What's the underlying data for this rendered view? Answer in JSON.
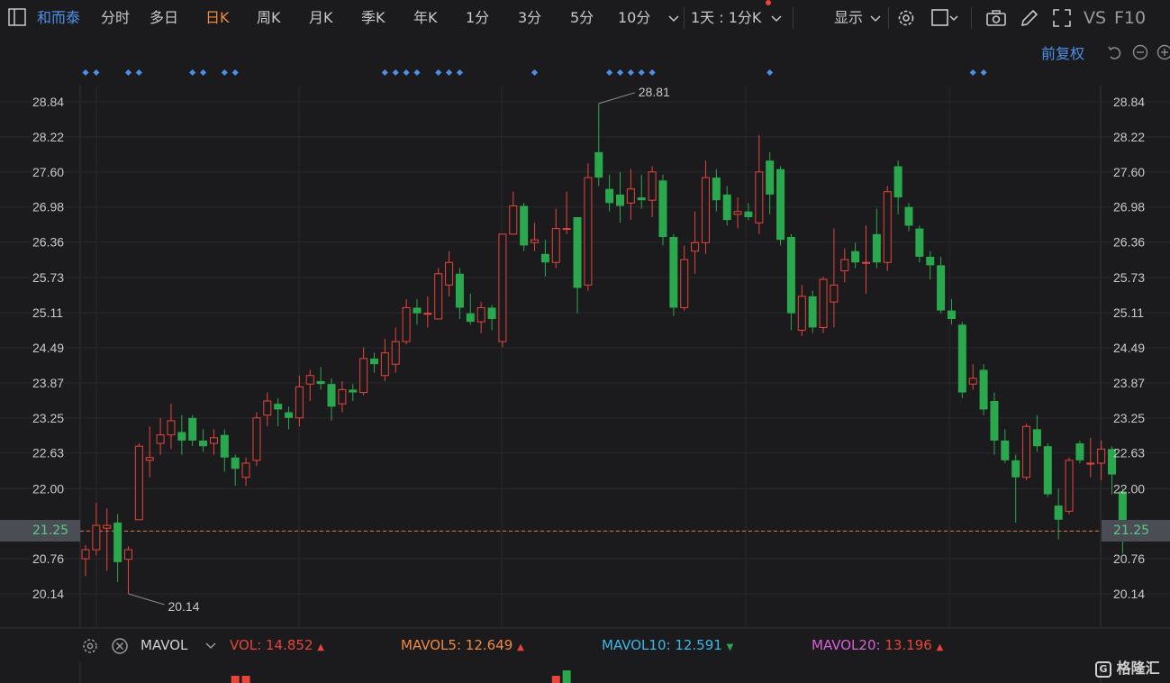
{
  "toolbar": {
    "stock_name": "和而泰",
    "tabs": [
      "分时",
      "多日",
      "日K",
      "周K",
      "月K",
      "季K",
      "年K",
      "1分",
      "3分",
      "5分",
      "10分"
    ],
    "active_tab": "日K",
    "interval_select": "1天 : 1分K",
    "display_label": "显示",
    "vs_label": "VS",
    "f10_label": "F10",
    "icons": [
      "layout-icon",
      "chevron-down-icon",
      "gear-icon",
      "square-icon",
      "camera-icon",
      "pencil-icon",
      "expand-icon"
    ]
  },
  "adjust_label": "前复权",
  "chart_data": {
    "type": "candlestick",
    "y_ticks": [
      "28.84",
      "28.22",
      "27.60",
      "26.98",
      "26.36",
      "25.73",
      "25.11",
      "24.49",
      "23.87",
      "23.25",
      "22.63",
      "22.00",
      "21.25",
      "20.76",
      "20.14"
    ],
    "ylim": [
      19.75,
      29.2
    ],
    "current_price": "21.25",
    "high_label": "28.81",
    "low_label": "20.14",
    "candles": [
      [
        20.76,
        20.92,
        20.45,
        21.0
      ],
      [
        20.92,
        21.35,
        20.82,
        21.75
      ],
      [
        21.3,
        21.35,
        20.55,
        21.65
      ],
      [
        21.4,
        20.7,
        20.35,
        21.55
      ],
      [
        20.75,
        20.92,
        20.14,
        20.98
      ],
      [
        21.45,
        22.75,
        21.45,
        22.8
      ],
      [
        22.5,
        22.55,
        22.2,
        23.1
      ],
      [
        22.8,
        22.95,
        22.6,
        23.25
      ],
      [
        22.95,
        23.2,
        22.7,
        23.5
      ],
      [
        23.0,
        22.85,
        22.6,
        23.3
      ],
      [
        23.25,
        22.85,
        22.75,
        23.3
      ],
      [
        22.85,
        22.75,
        22.65,
        23.05
      ],
      [
        22.8,
        22.9,
        22.6,
        23.05
      ],
      [
        22.95,
        22.55,
        22.3,
        23.05
      ],
      [
        22.55,
        22.35,
        22.05,
        22.6
      ],
      [
        22.2,
        22.45,
        22.05,
        22.55
      ],
      [
        22.5,
        23.25,
        22.4,
        23.35
      ],
      [
        23.3,
        23.55,
        23.1,
        23.7
      ],
      [
        23.5,
        23.4,
        23.1,
        23.6
      ],
      [
        23.35,
        23.25,
        23.05,
        23.45
      ],
      [
        23.25,
        23.8,
        23.1,
        24.0
      ],
      [
        23.85,
        24.0,
        23.55,
        24.1
      ],
      [
        23.9,
        23.85,
        23.75,
        24.15
      ],
      [
        23.85,
        23.45,
        23.2,
        23.95
      ],
      [
        23.5,
        23.75,
        23.35,
        23.9
      ],
      [
        23.75,
        23.7,
        23.55,
        23.85
      ],
      [
        23.7,
        24.3,
        23.65,
        24.5
      ],
      [
        24.3,
        24.2,
        24.05,
        24.4
      ],
      [
        24.0,
        24.4,
        23.9,
        24.65
      ],
      [
        24.2,
        24.6,
        24.05,
        24.85
      ],
      [
        24.6,
        25.2,
        24.55,
        25.35
      ],
      [
        25.2,
        25.1,
        24.9,
        25.35
      ],
      [
        25.1,
        25.1,
        24.85,
        25.4
      ],
      [
        25.0,
        25.8,
        25.0,
        25.9
      ],
      [
        25.6,
        26.0,
        25.4,
        26.2
      ],
      [
        25.8,
        25.2,
        25.0,
        25.9
      ],
      [
        25.1,
        24.95,
        24.9,
        25.45
      ],
      [
        24.95,
        25.2,
        24.75,
        25.3
      ],
      [
        25.2,
        25.0,
        24.8,
        25.25
      ],
      [
        24.6,
        26.5,
        24.5,
        26.5
      ],
      [
        26.5,
        27.0,
        26.55,
        27.25
      ],
      [
        27.0,
        26.3,
        26.2,
        27.05
      ],
      [
        26.35,
        26.4,
        26.2,
        26.7
      ],
      [
        26.15,
        26.0,
        25.75,
        26.4
      ],
      [
        26.0,
        26.6,
        25.9,
        26.95
      ],
      [
        26.6,
        26.6,
        26.5,
        27.25
      ],
      [
        26.8,
        25.55,
        25.1,
        26.8
      ],
      [
        25.6,
        27.5,
        25.5,
        27.75
      ],
      [
        27.95,
        27.5,
        27.35,
        28.81
      ],
      [
        27.3,
        27.05,
        26.9,
        27.55
      ],
      [
        27.2,
        27.0,
        26.7,
        27.6
      ],
      [
        27.05,
        27.3,
        26.75,
        27.65
      ],
      [
        27.15,
        27.1,
        26.95,
        27.55
      ],
      [
        27.1,
        27.6,
        26.8,
        27.7
      ],
      [
        27.45,
        26.45,
        26.3,
        27.55
      ],
      [
        26.45,
        25.2,
        25.05,
        26.5
      ],
      [
        25.2,
        26.05,
        25.15,
        26.3
      ],
      [
        26.2,
        26.35,
        25.8,
        26.9
      ],
      [
        26.35,
        27.5,
        26.15,
        27.8
      ],
      [
        27.5,
        27.1,
        26.9,
        27.65
      ],
      [
        27.2,
        26.75,
        26.65,
        27.35
      ],
      [
        26.85,
        26.9,
        26.6,
        27.15
      ],
      [
        26.9,
        26.8,
        26.75,
        27.05
      ],
      [
        26.7,
        27.6,
        26.5,
        28.25
      ],
      [
        27.8,
        27.2,
        26.85,
        27.95
      ],
      [
        27.65,
        26.4,
        26.3,
        27.7
      ],
      [
        26.45,
        25.1,
        24.8,
        26.5
      ],
      [
        24.8,
        25.4,
        24.7,
        25.6
      ],
      [
        25.4,
        24.85,
        24.75,
        25.5
      ],
      [
        24.85,
        25.7,
        24.75,
        25.75
      ],
      [
        25.3,
        25.6,
        24.85,
        26.6
      ],
      [
        25.85,
        26.05,
        25.65,
        26.25
      ],
      [
        26.2,
        26.0,
        25.9,
        26.35
      ],
      [
        26.0,
        26.0,
        25.45,
        26.65
      ],
      [
        26.5,
        26.0,
        25.9,
        26.95
      ],
      [
        26.0,
        27.25,
        25.85,
        27.35
      ],
      [
        27.7,
        27.15,
        26.85,
        27.8
      ],
      [
        26.98,
        26.65,
        26.55,
        27.05
      ],
      [
        26.6,
        26.1,
        26.0,
        26.65
      ],
      [
        26.1,
        25.95,
        25.7,
        26.2
      ],
      [
        25.95,
        25.15,
        25.1,
        26.1
      ],
      [
        25.15,
        25.0,
        24.9,
        25.35
      ],
      [
        24.9,
        23.7,
        23.6,
        24.95
      ],
      [
        23.85,
        23.95,
        23.75,
        24.2
      ],
      [
        24.1,
        23.4,
        23.3,
        24.2
      ],
      [
        23.55,
        22.85,
        22.6,
        23.7
      ],
      [
        22.85,
        22.5,
        22.45,
        23.05
      ],
      [
        22.5,
        22.2,
        21.4,
        22.6
      ],
      [
        22.2,
        23.1,
        22.15,
        23.15
      ],
      [
        23.05,
        22.75,
        22.65,
        23.3
      ],
      [
        22.75,
        21.9,
        21.85,
        22.8
      ],
      [
        21.7,
        21.45,
        21.1,
        22.0
      ],
      [
        21.6,
        22.5,
        21.55,
        22.55
      ],
      [
        22.8,
        22.5,
        22.45,
        22.85
      ],
      [
        22.45,
        22.45,
        22.2,
        22.9
      ],
      [
        22.45,
        22.7,
        22.15,
        22.85
      ],
      [
        22.7,
        22.25,
        21.9,
        22.75
      ],
      [
        21.95,
        21.25,
        20.85,
        22.0
      ]
    ],
    "markers": [
      0,
      1,
      4,
      5,
      10,
      11,
      13,
      14,
      28,
      29,
      30,
      31,
      33,
      34,
      35,
      42,
      49,
      50,
      51,
      52,
      53,
      64,
      83,
      84
    ],
    "volume_label_prefix": "MAVOL"
  },
  "indicator_bar": {
    "name": "MAVOL",
    "items": [
      {
        "label": "VOL:",
        "value": "14.852",
        "color": "#e8443a",
        "arrow": "▲"
      },
      {
        "label": "MAVOL5:",
        "value": "12.649",
        "color": "#f08a3e",
        "arrow": "▲"
      },
      {
        "label": "MAVOL10:",
        "value": "12.591",
        "color": "#3ab7e8",
        "arrow": "▼"
      },
      {
        "label": "MAVOL20:",
        "value": "13.196",
        "color": "#d95fd9",
        "arrow": "▲"
      }
    ]
  },
  "watermark": "格隆汇",
  "colors": {
    "up": "#e8443a",
    "down": "#2aa84e",
    "marker": "#4d8fe8",
    "dash": "#e0793c"
  }
}
